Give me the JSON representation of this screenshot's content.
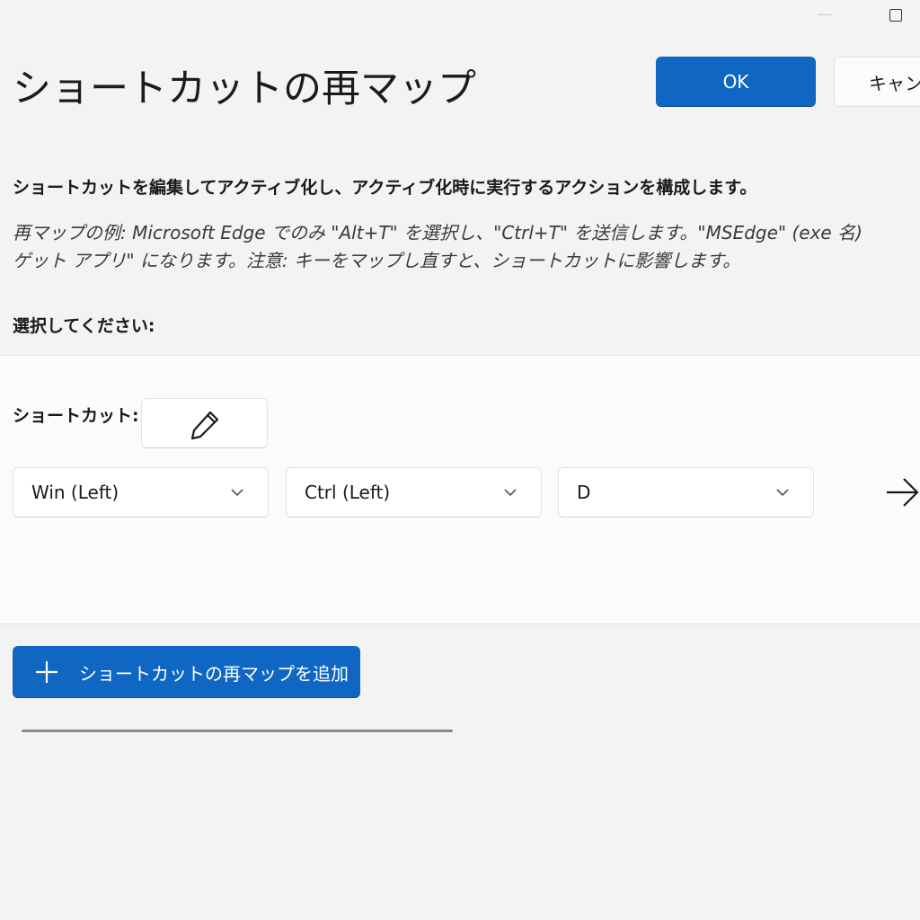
{
  "window": {
    "title": "ショートカットの再マップ"
  },
  "header": {
    "ok_label": "OK",
    "cancel_label": "キャンセル"
  },
  "description": "ショートカットを編集してアクティブ化し、アクティブ化時に実行するアクションを構成します。",
  "example_lines": [
    "再マップの例: Microsoft Edge でのみ \"Alt+T\" を選択し、\"Ctrl+T\" を送信します。\"MSEdge\" (exe 名)",
    "ゲット アプリ\" になります。注意: キーをマップし直すと、ショートカットに影響します。"
  ],
  "select_label": "選択してください:",
  "mapping": {
    "shortcut_label": "ショートカット:",
    "edit_icon": "pencil-icon",
    "keys": [
      "Win (Left)",
      "Ctrl (Left)",
      "D"
    ],
    "arrow_icon": "arrow-right-icon"
  },
  "add_button": {
    "label": "ショートカットの再マップを追加",
    "icon": "plus-icon"
  },
  "progress": {
    "value": 1.0
  }
}
